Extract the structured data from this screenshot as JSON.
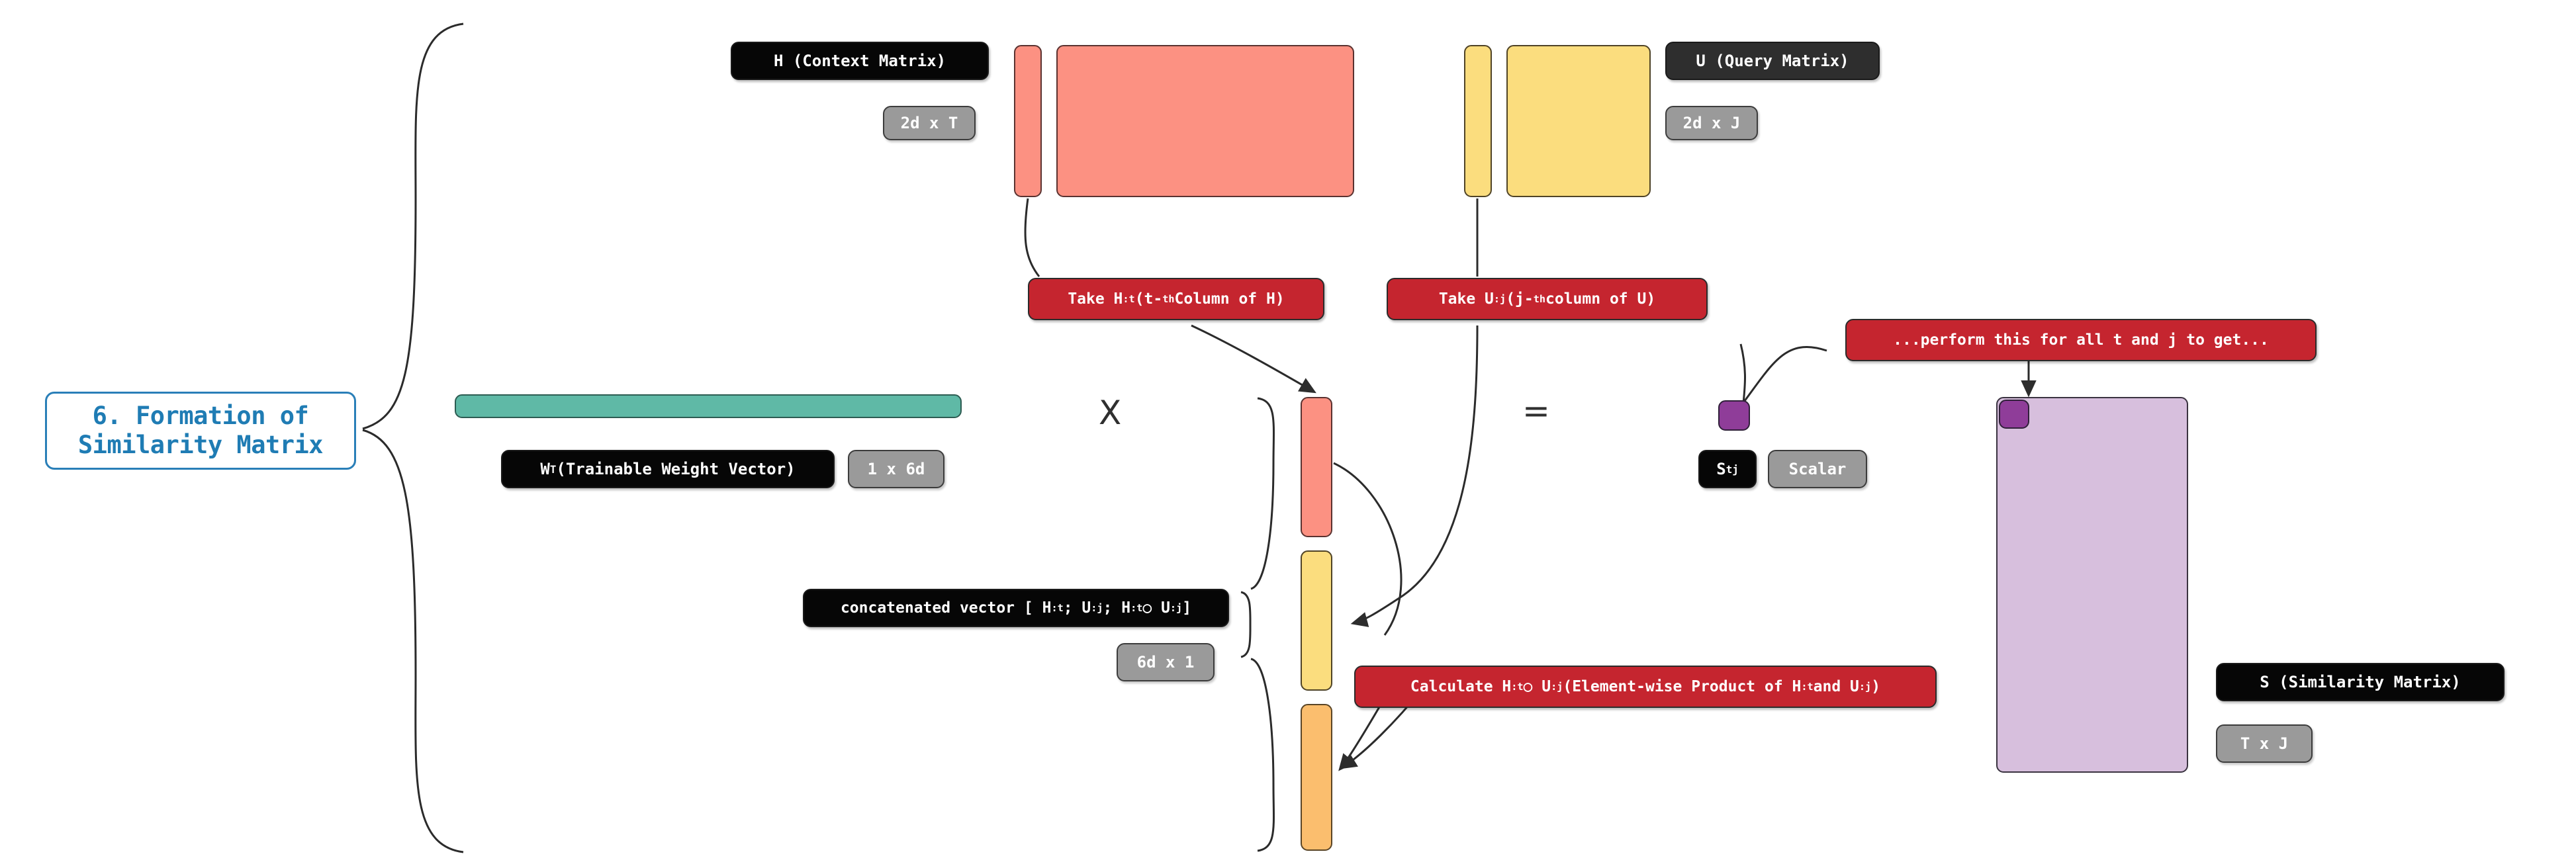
{
  "section": {
    "title": "6. Formation of\nSimilarity Matrix",
    "accent_color": "#1f7cb4"
  },
  "matrices": {
    "context": {
      "name_label": "H (Context Matrix)",
      "shape_label": "2d x T",
      "color": "#fc9182"
    },
    "query": {
      "name_label": "U (Query Matrix)",
      "shape_label": "2d x J",
      "color": "#fbdd7e"
    },
    "weight": {
      "name_label": "Wₜ (Trainable Weight Vector)",
      "name_main": "W",
      "name_sub": "T",
      "name_rest": " (Trainable Weight Vector)",
      "shape_label": "1 x 6d",
      "color": "#5fb9a6"
    },
    "concat": {
      "name_label": "concatenated vector [ H:t ; U:j ; H:t ○ U:j]",
      "shape_label": "6d x 1",
      "segment_top_color": "#fc9182",
      "segment_mid_color": "#fbdd7e",
      "segment_bottom_color": "#fbbe6e"
    },
    "similarity": {
      "name_label": "S (Similarity Matrix)",
      "shape_label": "T x J",
      "color": "#d7bfdd",
      "cell_color": "#8f3d99"
    },
    "scalar": {
      "name_label": "Sₜⱼ",
      "name_main": "S",
      "name_sub": "tj",
      "shape_label": "Scalar",
      "color": "#8f3d99"
    }
  },
  "annotations": {
    "take_h": {
      "prefix": "Take H",
      "sub": ":t",
      "mid": " (t-",
      "sup": "th",
      "suffix": " Column of H)",
      "full": "Take H:t (t-th Column of H)",
      "color": "#c5252f"
    },
    "take_u": {
      "prefix": "Take U",
      "sub": ":j",
      "mid": " (j-",
      "sup": "th",
      "suffix": " column of U)",
      "full": "Take U:j (j-th column of U)",
      "color": "#c5252f"
    },
    "elementwise": {
      "full": "Calculate H:t ○ U:j (Element-wise Product of H:t and U:j)",
      "color": "#c5252f"
    },
    "repeat": {
      "full": "...perform this for all t and j to get...",
      "color": "#c5252f"
    }
  },
  "operators": {
    "multiply": "X",
    "equals": "="
  },
  "concat_label_parts": {
    "p1": "concatenated vector [ H",
    "s1": ":t",
    "p2": " ; U",
    "s2": ":j",
    "p3": " ; H",
    "s3": ":t",
    "p4": " ○ U",
    "s4": ":j",
    "p5": "]"
  },
  "elementwise_label_parts": {
    "p1": "Calculate H",
    "s1": ":t",
    "p2": " ○ U",
    "s2": ":j",
    "p3": " (Element-wise Product of H",
    "s3": ":t",
    "p4": " and U",
    "s4": ":j",
    "p5": ")"
  }
}
